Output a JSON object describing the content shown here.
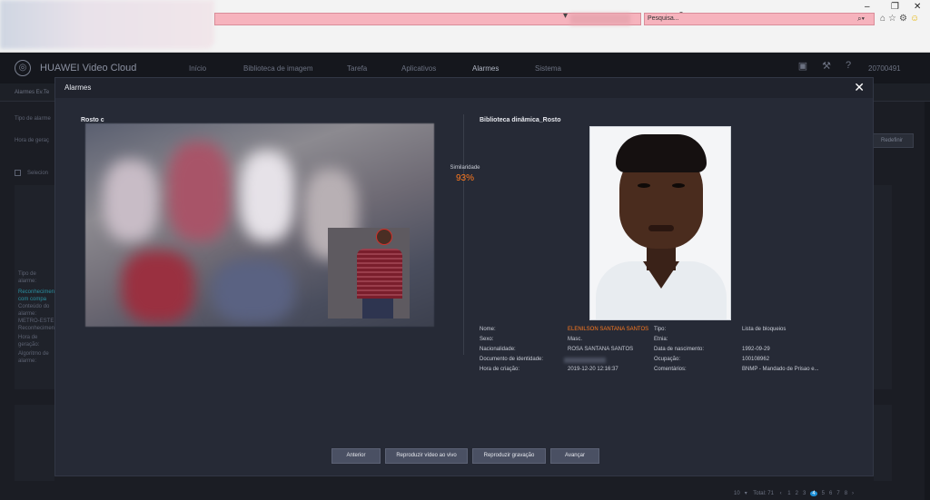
{
  "browser": {
    "search_placeholder": "Pesquisa...",
    "win_min": "–",
    "win_max": "❐",
    "win_close": "✕",
    "addr_icons": "▾ ↻",
    "search_icon": "⌕▾",
    "toolbar_icons": "⌂☆⚙",
    "toolbar_smiley": "☺"
  },
  "app": {
    "title": "HUAWEI Video Cloud",
    "nav": [
      "Início",
      "Biblioteca de imagem",
      "Tarefa",
      "Aplicativos",
      "Alarmes",
      "Sistema"
    ],
    "active_nav": "Alarmes",
    "user": "20700491"
  },
  "background": {
    "sub_header": "Alarmes Ev.Te",
    "labels": [
      "Tipo de alarme",
      "Hora de geraç"
    ],
    "select_label": "Selecion",
    "reset_button": "Redefinir",
    "side_texts": [
      {
        "text": "Tipo de alarme:",
        "link": false
      },
      {
        "text": "Reconhecimen com compa",
        "link": true
      },
      {
        "text": "Conteúdo do alarme:",
        "link": false
      },
      {
        "text": "METRO-ESTE Reconhecimen",
        "link": false
      },
      {
        "text": "Hora de geração:",
        "link": false
      },
      {
        "text": "Algoritmo de alarme:",
        "link": false
      }
    ]
  },
  "pagination": {
    "page_size": "10",
    "total": "Total: 71",
    "pages": [
      "1",
      "2",
      "3",
      "4",
      "5",
      "6",
      "7",
      "8"
    ],
    "current": "4"
  },
  "modal": {
    "title": "Alarmes",
    "left_title": "Rosto c",
    "right_title": "Biblioteca dinâmica_Rosto",
    "similarity_label": "Similaridade",
    "similarity_value": "93%",
    "info_left": [
      {
        "label": "Nome:",
        "value": "ELENILSON SANTANA SANTOS",
        "highlight": true
      },
      {
        "label": "Sexo:",
        "value": "Masc.",
        "highlight": false
      },
      {
        "label": "Nacionalidade:",
        "value": "ROSA SANTANA SANTOS",
        "highlight": false
      },
      {
        "label": "Documento de identidade:",
        "value": "",
        "highlight": false
      },
      {
        "label": "Hora de criação:",
        "value": "2019-12-20 12:16:37",
        "highlight": false
      }
    ],
    "info_right": [
      {
        "label": "Tipo:",
        "value": "Lista de bloqueios"
      },
      {
        "label": "Etnia:",
        "value": ""
      },
      {
        "label": "Data de nascimento:",
        "value": "1992-09-29"
      },
      {
        "label": "Ocupação:",
        "value": "100108962"
      },
      {
        "label": "Comentários:",
        "value": "BNMP - Mandado de Prisao e..."
      }
    ],
    "buttons": [
      "Anterior",
      "Reproduzir vídeo ao vivo",
      "Reproduzir gravação",
      "Avançar"
    ]
  }
}
